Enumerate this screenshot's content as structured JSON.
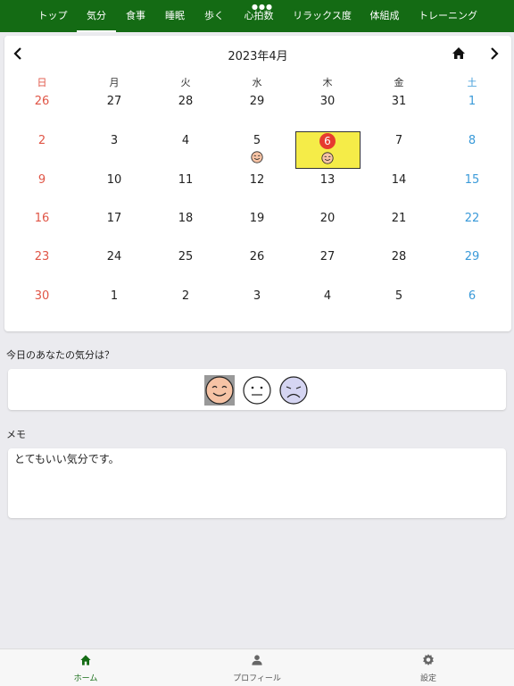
{
  "top_tabs": [
    {
      "label": "トップ",
      "active": false
    },
    {
      "label": "気分",
      "active": true
    },
    {
      "label": "食事",
      "active": false
    },
    {
      "label": "睡眠",
      "active": false
    },
    {
      "label": "歩く",
      "active": false
    },
    {
      "label": "心拍数",
      "active": false
    },
    {
      "label": "リラックス度",
      "active": false
    },
    {
      "label": "体組成",
      "active": false
    },
    {
      "label": "トレーニング",
      "active": false
    }
  ],
  "calendar": {
    "month_title": "2023年4月",
    "weekdays": [
      "日",
      "月",
      "火",
      "水",
      "木",
      "金",
      "土"
    ],
    "weeks": [
      [
        "26",
        "27",
        "28",
        "29",
        "30",
        "31",
        "1"
      ],
      [
        "2",
        "3",
        "4",
        "5",
        "6",
        "7",
        "8"
      ],
      [
        "9",
        "10",
        "11",
        "12",
        "13",
        "14",
        "15"
      ],
      [
        "16",
        "17",
        "18",
        "19",
        "20",
        "21",
        "22"
      ],
      [
        "23",
        "24",
        "25",
        "26",
        "27",
        "28",
        "29"
      ],
      [
        "30",
        "1",
        "2",
        "3",
        "4",
        "5",
        "6"
      ]
    ],
    "today": "6",
    "mood_marked_days": [
      "5",
      "6"
    ]
  },
  "mood": {
    "question": "今日のあなたの気分は？",
    "selected": "happy",
    "options": [
      "happy",
      "neutral",
      "sad"
    ]
  },
  "memo": {
    "label": "メモ",
    "text": "とてもいい気分です。"
  },
  "bottom_tabs": [
    {
      "label": "ホーム",
      "icon": "home-icon",
      "active": true
    },
    {
      "label": "プロフィール",
      "icon": "person-icon",
      "active": false
    },
    {
      "label": "設定",
      "icon": "gear-icon",
      "active": false
    }
  ],
  "colors": {
    "brand_green": "#146b14",
    "sunday_red": "#e05546",
    "saturday_blue": "#3a9ad9",
    "today_highlight": "#f5ec48",
    "today_badge": "#e63b2f"
  }
}
